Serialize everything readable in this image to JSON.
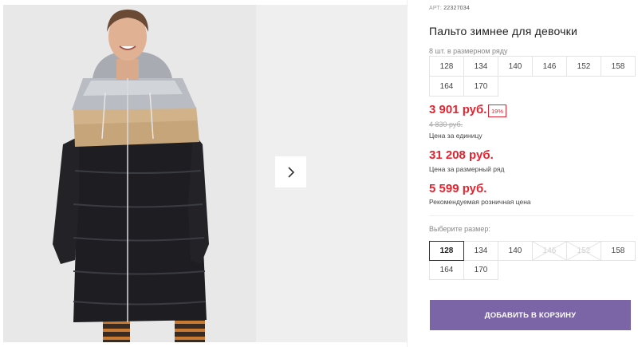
{
  "product": {
    "article_label": "АРТ:",
    "article_code": "22327034",
    "title": "Пальто зимнее для девочки"
  },
  "size_row": {
    "note": "8 шт. в размерном ряду",
    "sizes": [
      "128",
      "134",
      "140",
      "146",
      "152",
      "158",
      "164",
      "170"
    ]
  },
  "prices": {
    "current": "3 901 руб.",
    "discount": "19%",
    "old": "4 830 руб.",
    "unit_label": "Цена за единицу",
    "row_price": "31 208 руб.",
    "row_label": "Цена за размерный ряд",
    "rrp": "5 599 руб.",
    "rrp_label": "Рекомендуемая розничная цена"
  },
  "size_select": {
    "label": "Выберите размер:",
    "options": [
      {
        "label": "128",
        "state": "selected"
      },
      {
        "label": "134",
        "state": "available"
      },
      {
        "label": "140",
        "state": "available"
      },
      {
        "label": "146",
        "state": "unavailable"
      },
      {
        "label": "152",
        "state": "unavailable"
      },
      {
        "label": "158",
        "state": "available"
      },
      {
        "label": "164",
        "state": "available"
      },
      {
        "label": "170",
        "state": "available"
      }
    ]
  },
  "cart_button": {
    "label": "ДОБАВИТЬ В КОРЗИНУ"
  },
  "colors": {
    "price_red": "#e3232f",
    "button_purple": "#7b65a6",
    "coat_black": "#1e1e22",
    "coat_silver": "#b9bcc2",
    "coat_gold": "#c7a57b"
  },
  "icons": {
    "next": "chevron-right-icon"
  }
}
